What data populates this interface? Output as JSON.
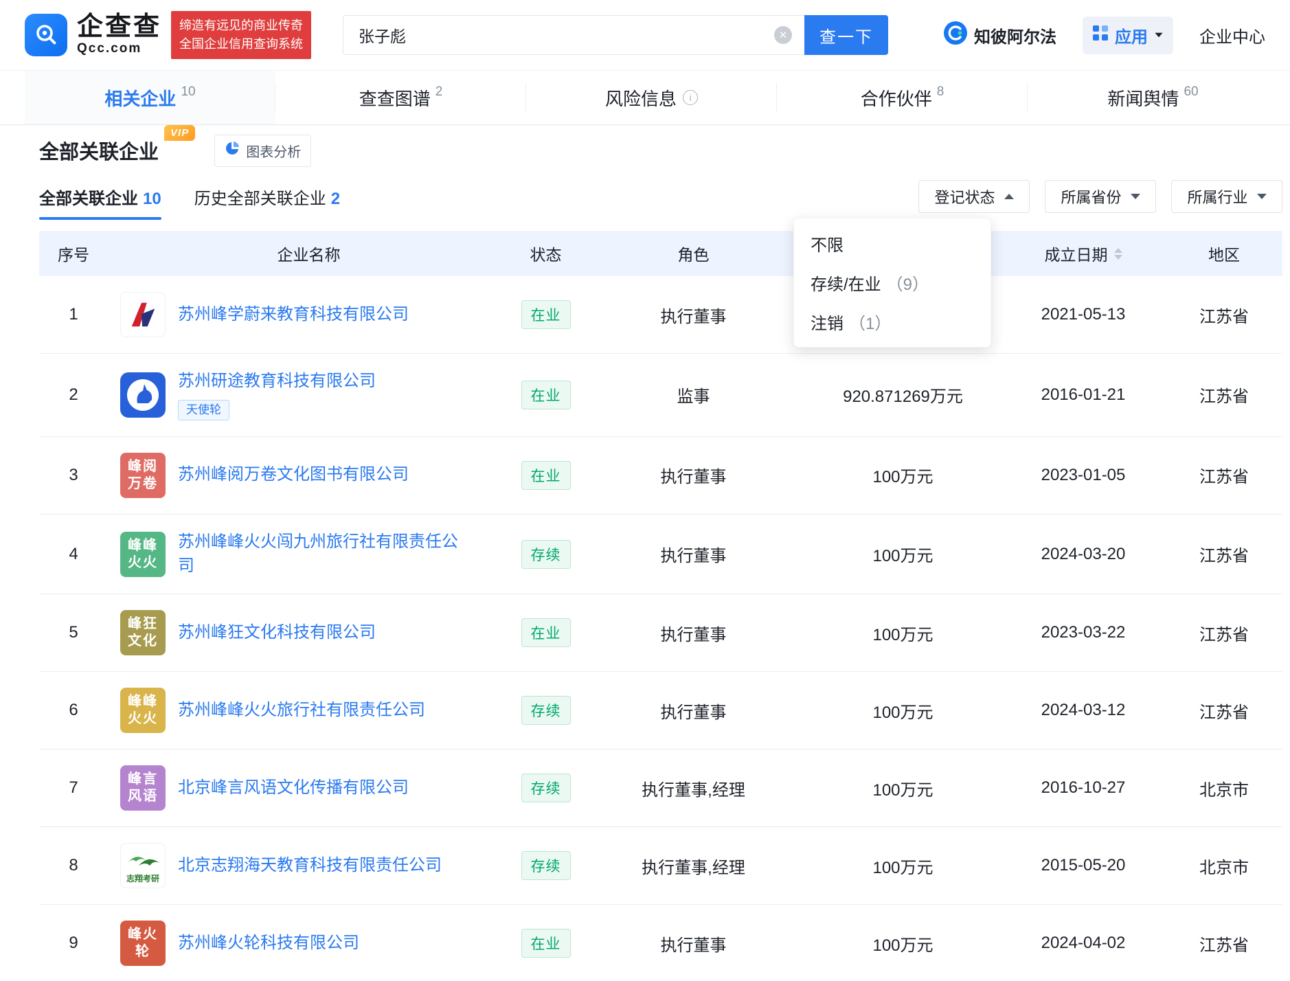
{
  "header": {
    "logo_text": "企查查",
    "logo_sub": "Qcc.com",
    "slogan_line1": "缔造有远见的商业传奇",
    "slogan_line2": "全国企业信用查询系统",
    "search_value": "张子彪",
    "search_button": "查一下",
    "zhibi_alpha": "知彼阿尔法",
    "apps_label": "应用",
    "enterprise_center": "企业中心"
  },
  "tabs": [
    {
      "key": "related-companies",
      "label": "相关企业",
      "count": "10",
      "active": true,
      "info": false
    },
    {
      "key": "chart-graph",
      "label": "查查图谱",
      "count": "2",
      "active": false,
      "info": false
    },
    {
      "key": "risk-info",
      "label": "风险信息",
      "count": "",
      "active": false,
      "info": true
    },
    {
      "key": "partners",
      "label": "合作伙伴",
      "count": "8",
      "active": false,
      "info": false
    },
    {
      "key": "news-sentiment",
      "label": "新闻舆情",
      "count": "60",
      "active": false,
      "info": false
    }
  ],
  "section": {
    "title": "全部关联企业",
    "vip_badge": "VIP",
    "chart_analysis_label": "图表分析"
  },
  "subtabs": [
    {
      "key": "all-related",
      "label": "全部关联企业",
      "count": "10",
      "active": true
    },
    {
      "key": "history-related",
      "label": "历史全部关联企业",
      "count": "2",
      "active": false
    }
  ],
  "filters": [
    {
      "key": "registration-status",
      "label": "登记状态",
      "state": "open"
    },
    {
      "key": "province",
      "label": "所属省份",
      "state": "closed"
    },
    {
      "key": "industry",
      "label": "所属行业",
      "state": "closed"
    }
  ],
  "status_dropdown": {
    "options": [
      {
        "label": "不限",
        "count": ""
      },
      {
        "label": "存续/在业",
        "count": "（9）"
      },
      {
        "label": "注销",
        "count": "（1）"
      }
    ]
  },
  "table": {
    "columns": [
      {
        "key": "no",
        "label": "序号",
        "sortable": false
      },
      {
        "key": "name",
        "label": "企业名称",
        "sortable": false
      },
      {
        "key": "status",
        "label": "状态",
        "sortable": false
      },
      {
        "key": "role",
        "label": "角色",
        "sortable": false
      },
      {
        "key": "capital",
        "label": "",
        "sortable": false
      },
      {
        "key": "date",
        "label": "成立日期",
        "sortable": true
      },
      {
        "key": "region",
        "label": "地区",
        "sortable": false
      }
    ],
    "rows": [
      {
        "no": "1",
        "name": "苏州峰学蔚来教育科技有限公司",
        "tag": "",
        "status": "在业",
        "role": "执行董事",
        "capital": "",
        "date": "2021-05-13",
        "region": "江苏省",
        "logo": {
          "kind": "fengxue"
        }
      },
      {
        "no": "2",
        "name": "苏州研途教育科技有限公司",
        "tag": "天使轮",
        "status": "在业",
        "role": "监事",
        "capital": "920.871269万元",
        "date": "2016-01-21",
        "region": "江苏省",
        "logo": {
          "kind": "yantu"
        }
      },
      {
        "no": "3",
        "name": "苏州峰阅万卷文化图书有限公司",
        "tag": "",
        "status": "在业",
        "role": "执行董事",
        "capital": "100万元",
        "date": "2023-01-05",
        "region": "江苏省",
        "logo": {
          "kind": "text",
          "lines": [
            "峰阅",
            "万卷"
          ],
          "bg": "#df6c64"
        }
      },
      {
        "no": "4",
        "name": "苏州峰峰火火闯九州旅行社有限责任公司",
        "tag": "",
        "status": "存续",
        "role": "执行董事",
        "capital": "100万元",
        "date": "2024-03-20",
        "region": "江苏省",
        "logo": {
          "kind": "text",
          "lines": [
            "峰峰",
            "火火"
          ],
          "bg": "#55b786"
        }
      },
      {
        "no": "5",
        "name": "苏州峰狂文化科技有限公司",
        "tag": "",
        "status": "在业",
        "role": "执行董事",
        "capital": "100万元",
        "date": "2023-03-22",
        "region": "江苏省",
        "logo": {
          "kind": "text",
          "lines": [
            "峰狂",
            "文化"
          ],
          "bg": "#a79b4f"
        }
      },
      {
        "no": "6",
        "name": "苏州峰峰火火旅行社有限责任公司",
        "tag": "",
        "status": "存续",
        "role": "执行董事",
        "capital": "100万元",
        "date": "2024-03-12",
        "region": "江苏省",
        "logo": {
          "kind": "text",
          "lines": [
            "峰峰",
            "火火"
          ],
          "bg": "#d9b44a"
        }
      },
      {
        "no": "7",
        "name": "北京峰言风语文化传播有限公司",
        "tag": "",
        "status": "存续",
        "role": "执行董事,经理",
        "capital": "100万元",
        "date": "2016-10-27",
        "region": "北京市",
        "logo": {
          "kind": "text",
          "lines": [
            "峰言",
            "风语"
          ],
          "bg": "#b584cf"
        }
      },
      {
        "no": "8",
        "name": "北京志翔海天教育科技有限责任公司",
        "tag": "",
        "status": "存续",
        "role": "执行董事,经理",
        "capital": "100万元",
        "date": "2015-05-20",
        "region": "北京市",
        "logo": {
          "kind": "zhixiang",
          "caption": "志翔考研"
        }
      },
      {
        "no": "9",
        "name": "苏州峰火轮科技有限公司",
        "tag": "",
        "status": "在业",
        "role": "执行董事",
        "capital": "100万元",
        "date": "2024-04-02",
        "region": "江苏省",
        "logo": {
          "kind": "text",
          "lines": [
            "峰火",
            "轮"
          ],
          "bg": "#d45a41"
        }
      }
    ]
  },
  "colors": {
    "brand_blue": "#2a7af0",
    "status_green": "#00a870",
    "slogan_red": "#e03e3e",
    "table_header_bg": "#edf4ff"
  }
}
